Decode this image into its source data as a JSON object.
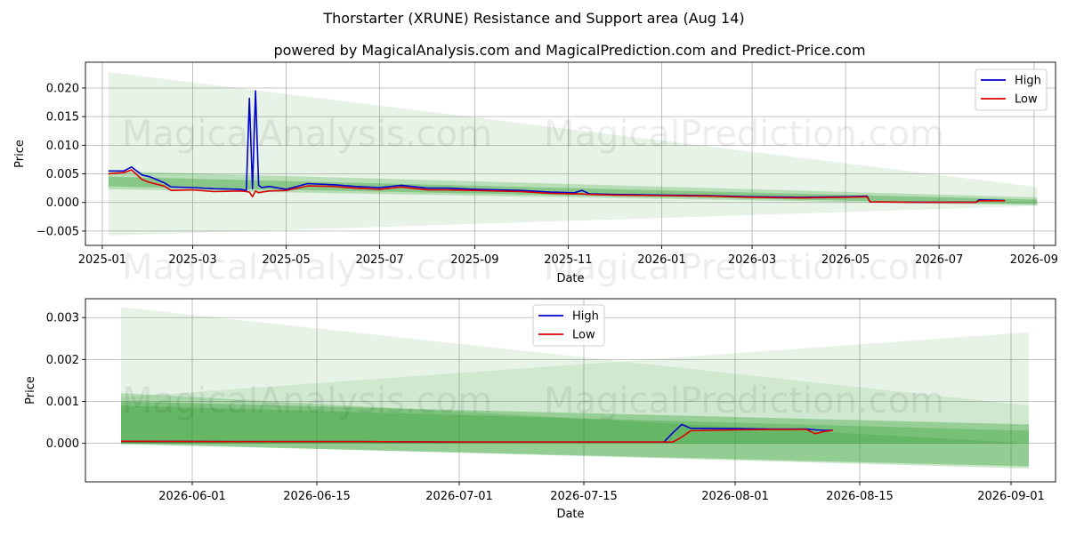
{
  "title": "Thorstarter (XRUNE) Resistance and Support area (Aug 14)",
  "subtitle": "powered by MagicalAnalysis.com and MagicalPrediction.com and Predict-Price.com",
  "watermarks": [
    "MagicalAnalysis.com",
    "MagicalPrediction.com"
  ],
  "colors": {
    "high": "#0000cc",
    "low": "#dd0000",
    "band": "#2e9e2e"
  },
  "chart_data": [
    {
      "type": "line",
      "xlabel": "Date",
      "ylabel": "Price",
      "x_ticks": [
        "2025-01",
        "2025-03",
        "2025-05",
        "2025-07",
        "2025-09",
        "2025-11",
        "2026-01",
        "2026-03",
        "2026-05",
        "2026-07",
        "2026-09"
      ],
      "y_ticks": [
        "−0.005",
        "0.000",
        "0.005",
        "0.010",
        "0.015",
        "0.020"
      ],
      "xlim": [
        "2024-12-21",
        "2026-09-15"
      ],
      "ylim": [
        -0.0075,
        0.0245
      ],
      "grid": true,
      "legend": {
        "position": "top-right",
        "entries": [
          "High",
          "Low"
        ]
      },
      "series": [
        {
          "name": "High",
          "x": [
            "2025-01-05",
            "2025-01-15",
            "2025-01-20",
            "2025-01-27",
            "2025-02-01",
            "2025-02-10",
            "2025-02-15",
            "2025-03-01",
            "2025-03-15",
            "2025-04-01",
            "2025-04-05",
            "2025-04-07",
            "2025-04-09",
            "2025-04-11",
            "2025-04-13",
            "2025-04-15",
            "2025-04-20",
            "2025-05-01",
            "2025-05-15",
            "2025-06-01",
            "2025-06-15",
            "2025-07-01",
            "2025-07-15",
            "2025-08-01",
            "2025-08-15",
            "2025-09-01",
            "2025-09-15",
            "2025-10-01",
            "2025-10-20",
            "2025-11-05",
            "2025-11-10",
            "2025-11-15",
            "2025-12-01",
            "2026-01-01",
            "2026-02-01",
            "2026-03-01",
            "2026-04-01",
            "2026-05-01",
            "2026-05-15",
            "2026-05-17",
            "2026-06-15",
            "2026-07-15",
            "2026-07-25",
            "2026-07-27",
            "2026-08-13"
          ],
          "values": [
            0.0055,
            0.0055,
            0.0062,
            0.0048,
            0.0045,
            0.0035,
            0.0027,
            0.0026,
            0.0024,
            0.0023,
            0.0021,
            0.0182,
            0.0024,
            0.0195,
            0.003,
            0.0026,
            0.0028,
            0.0023,
            0.0033,
            0.0031,
            0.0028,
            0.0026,
            0.003,
            0.0025,
            0.0025,
            0.0023,
            0.0022,
            0.0021,
            0.0018,
            0.0017,
            0.0021,
            0.0015,
            0.0014,
            0.0013,
            0.0012,
            0.001,
            0.0009,
            0.001,
            0.0011,
            0.0001,
            5e-05,
            5e-05,
            5e-05,
            0.00045,
            0.00035
          ]
        },
        {
          "name": "Low",
          "x": [
            "2025-01-05",
            "2025-01-15",
            "2025-01-20",
            "2025-01-27",
            "2025-02-01",
            "2025-02-10",
            "2025-02-15",
            "2025-03-01",
            "2025-03-15",
            "2025-04-01",
            "2025-04-05",
            "2025-04-07",
            "2025-04-09",
            "2025-04-11",
            "2025-04-13",
            "2025-04-15",
            "2025-04-20",
            "2025-05-01",
            "2025-05-15",
            "2025-06-01",
            "2025-06-15",
            "2025-07-01",
            "2025-07-15",
            "2025-08-01",
            "2025-08-15",
            "2025-09-01",
            "2025-09-15",
            "2025-10-01",
            "2025-10-20",
            "2025-11-05",
            "2025-11-10",
            "2025-11-15",
            "2025-12-01",
            "2026-01-01",
            "2026-02-01",
            "2026-03-01",
            "2026-04-01",
            "2026-05-01",
            "2026-05-15",
            "2026-05-17",
            "2026-06-15",
            "2026-07-15",
            "2026-07-25",
            "2026-07-27",
            "2026-08-13"
          ],
          "values": [
            0.005,
            0.0052,
            0.0057,
            0.004,
            0.0035,
            0.0029,
            0.0021,
            0.0022,
            0.0019,
            0.002,
            0.0019,
            0.0018,
            0.001,
            0.002,
            0.0017,
            0.0018,
            0.002,
            0.0021,
            0.0029,
            0.0028,
            0.0025,
            0.0023,
            0.0027,
            0.0022,
            0.0022,
            0.0021,
            0.002,
            0.0019,
            0.0016,
            0.0015,
            0.0015,
            0.0014,
            0.0013,
            0.0012,
            0.0011,
            0.0009,
            0.0008,
            0.0009,
            0.001,
            0.0001,
            3e-05,
            2e-05,
            2e-05,
            0.0003,
            0.0003
          ]
        }
      ],
      "bands": [
        {
          "x0": "2025-01-05",
          "x1": "2026-09-03",
          "y0_top": 0.0228,
          "y0_bot": -0.0058,
          "y1_top": 0.0027,
          "y1_bot": -0.0006,
          "opacity": 0.12
        },
        {
          "x0": "2025-01-05",
          "x1": "2026-09-03",
          "y0_top": 0.0055,
          "y0_bot": 0.0023,
          "y1_top": 0.0009,
          "y1_bot": -0.0005,
          "opacity": 0.25
        },
        {
          "x0": "2025-01-05",
          "x1": "2026-09-03",
          "y0_top": 0.0045,
          "y0_bot": 0.0028,
          "y1_top": 0.0005,
          "y1_bot": -0.0003,
          "opacity": 0.35
        }
      ]
    },
    {
      "type": "line",
      "xlabel": "Date",
      "ylabel": "Price",
      "x_ticks": [
        "2026-06-01",
        "2026-06-15",
        "2026-07-01",
        "2026-07-15",
        "2026-08-01",
        "2026-08-15",
        "2026-09-01"
      ],
      "y_ticks": [
        "0.000",
        "0.001",
        "0.002",
        "0.003"
      ],
      "xlim": [
        "2026-05-20",
        "2026-09-06"
      ],
      "ylim": [
        -0.00092,
        0.00345
      ],
      "grid": true,
      "legend": {
        "position": "top-center",
        "entries": [
          "High",
          "Low"
        ]
      },
      "series": [
        {
          "name": "High",
          "x": [
            "2026-05-24",
            "2026-06-05",
            "2026-06-20",
            "2026-07-01",
            "2026-07-10",
            "2026-07-20",
            "2026-07-24",
            "2026-07-25",
            "2026-07-26",
            "2026-07-27",
            "2026-08-01",
            "2026-08-05",
            "2026-08-09",
            "2026-08-10",
            "2026-08-11",
            "2026-08-12"
          ],
          "values": [
            5e-05,
            4e-05,
            4e-05,
            3e-05,
            3e-05,
            3e-05,
            3e-05,
            0.00025,
            0.00045,
            0.00036,
            0.00035,
            0.00034,
            0.00034,
            0.00032,
            0.00031,
            0.00031
          ]
        },
        {
          "name": "Low",
          "x": [
            "2026-05-24",
            "2026-06-05",
            "2026-06-20",
            "2026-07-01",
            "2026-07-10",
            "2026-07-20",
            "2026-07-24",
            "2026-07-25",
            "2026-07-26",
            "2026-07-27",
            "2026-08-01",
            "2026-08-05",
            "2026-08-09",
            "2026-08-10",
            "2026-08-11",
            "2026-08-12"
          ],
          "values": [
            5e-05,
            4e-05,
            4e-05,
            3e-05,
            3e-05,
            3e-05,
            3e-05,
            3e-05,
            0.00015,
            0.0003,
            0.00032,
            0.00033,
            0.00033,
            0.00023,
            0.00028,
            0.00031
          ]
        }
      ],
      "bands": [
        {
          "x0": "2026-05-24",
          "x1": "2026-09-03",
          "y0_top": 0.00325,
          "y0_bot": 0.0,
          "y1_top": 0.0009,
          "y1_bot": 0.0,
          "opacity": 0.12
        },
        {
          "x0": "2026-05-24",
          "x1": "2026-09-03",
          "y0_top": 0.0011,
          "y0_bot": 0.0,
          "y1_top": 0.00265,
          "y1_bot": 0.0,
          "opacity": 0.12
        },
        {
          "x0": "2026-05-24",
          "x1": "2026-09-03",
          "y0_top": 0.0012,
          "y0_bot": 0.0,
          "y1_top": 0.0,
          "y1_bot": -0.0006,
          "opacity": 0.25
        },
        {
          "x0": "2026-05-24",
          "x1": "2026-09-03",
          "y0_top": 0.001,
          "y0_bot": 0.0,
          "y1_top": 0.00045,
          "y1_bot": 0.0,
          "opacity": 0.35
        },
        {
          "x0": "2026-05-24",
          "x1": "2026-09-03",
          "y0_top": 0.0009,
          "y0_bot": 0.0,
          "y1_top": 0.0003,
          "y1_bot": 0.0,
          "opacity": 0.3
        },
        {
          "x0": "2026-05-24",
          "x1": "2026-09-03",
          "y0_top": 5e-05,
          "y0_bot": -2e-05,
          "y1_top": 0.0,
          "y1_bot": -0.00055,
          "opacity": 0.35
        }
      ]
    }
  ]
}
